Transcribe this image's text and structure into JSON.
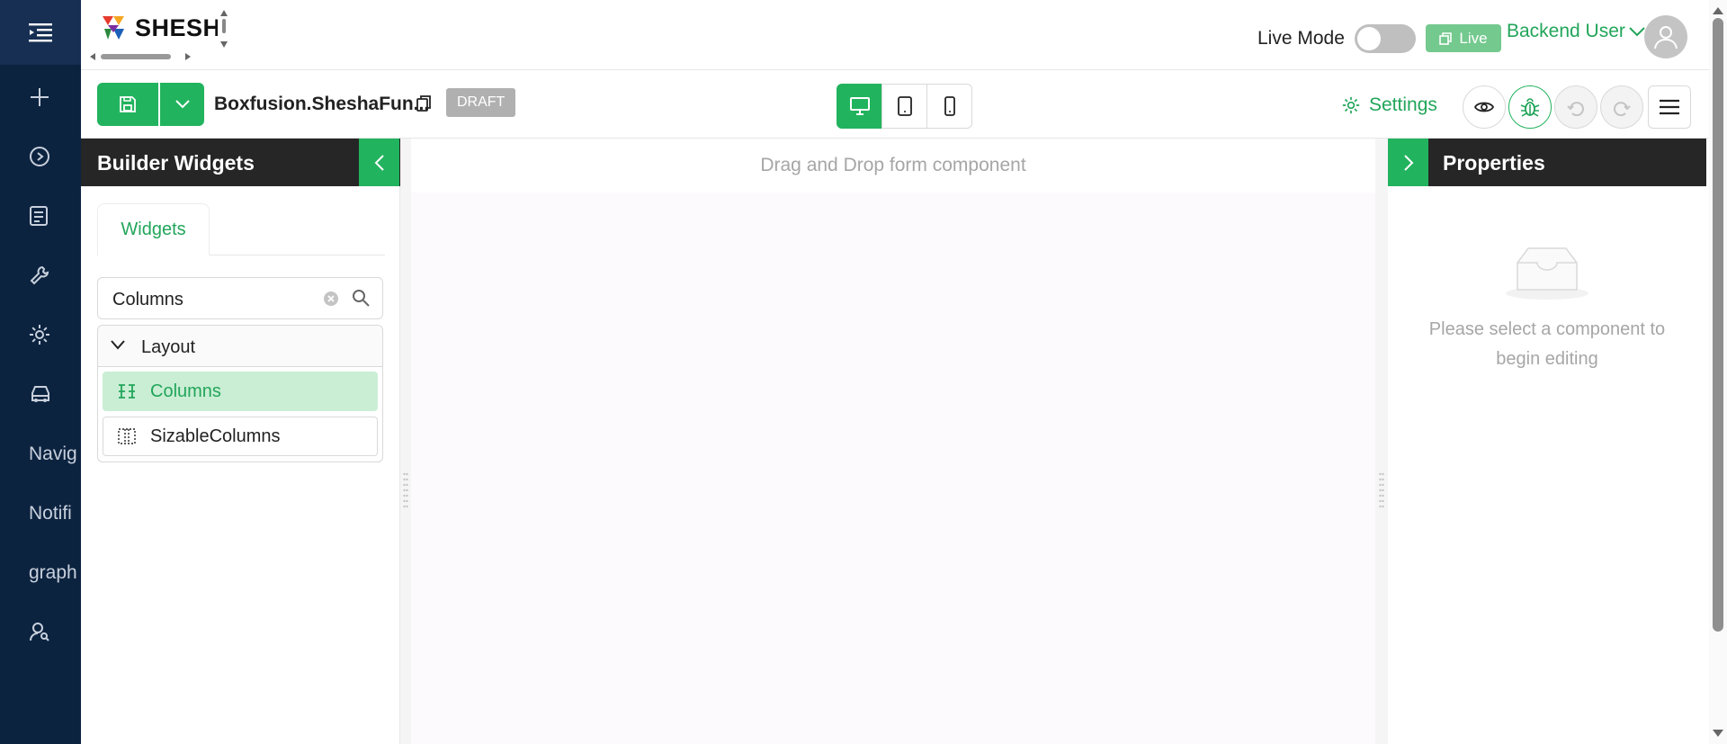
{
  "nav": {
    "items": [
      {
        "icon": "plus-icon"
      },
      {
        "icon": "play-circle-icon"
      },
      {
        "icon": "book-icon"
      },
      {
        "icon": "wrench-icon"
      },
      {
        "icon": "gear-icon"
      },
      {
        "icon": "car-icon"
      },
      {
        "label": "Navig"
      },
      {
        "label": "Notifi"
      },
      {
        "label": "graph"
      },
      {
        "icon": "user-search-icon"
      }
    ]
  },
  "header": {
    "logo_text": "SHESHA",
    "live_mode_label": "Live Mode",
    "live_mode_on": false,
    "live_button_label": "Live",
    "user_name": "Backend User"
  },
  "toolbar": {
    "form_name": "Boxfusion.SheshaFun...",
    "status_badge": "DRAFT",
    "settings_label": "Settings",
    "device_modes": [
      "desktop",
      "tablet",
      "mobile"
    ],
    "active_device": "desktop"
  },
  "left_panel": {
    "title": "Builder Widgets",
    "tab_label": "Widgets",
    "search_value": "Columns",
    "group_label": "Layout",
    "widgets": [
      {
        "label": "Columns",
        "selected": true
      },
      {
        "label": "SizableColumns",
        "selected": false
      }
    ]
  },
  "canvas": {
    "hint": "Drag and Drop form component"
  },
  "right_panel": {
    "title": "Properties",
    "empty_line1": "Please select a component to",
    "empty_line2": "begin editing"
  },
  "colors": {
    "accent": "#22b35e",
    "nav_bg": "#0c2340",
    "panel_header": "#262626"
  }
}
